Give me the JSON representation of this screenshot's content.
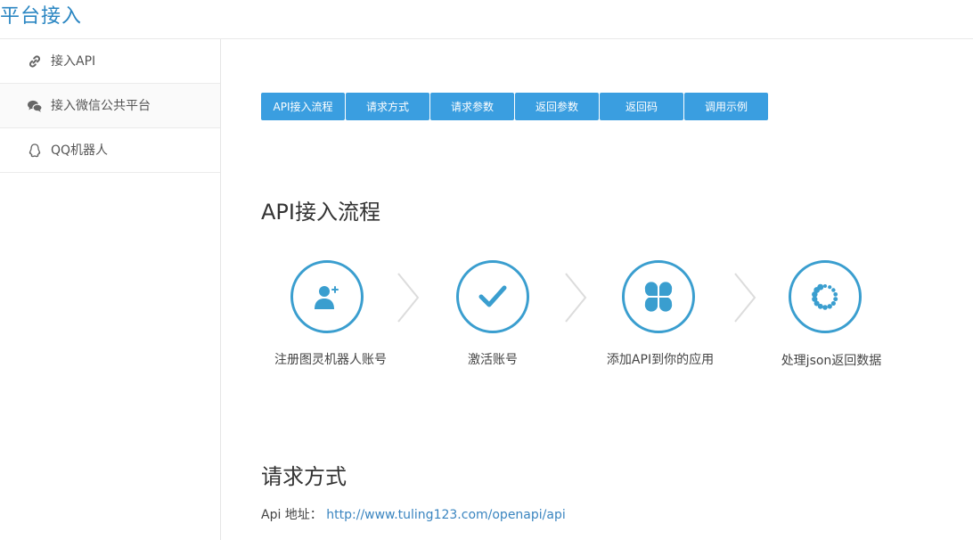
{
  "header": {
    "title": "平台接入"
  },
  "sidebar": {
    "items": [
      {
        "label": "接入API",
        "icon": "link-icon"
      },
      {
        "label": "接入微信公共平台",
        "icon": "wechat-icon"
      },
      {
        "label": "QQ机器人",
        "icon": "qq-icon"
      }
    ]
  },
  "tabs": [
    {
      "label": "API接入流程"
    },
    {
      "label": "请求方式"
    },
    {
      "label": "请求参数"
    },
    {
      "label": "返回参数"
    },
    {
      "label": "返回码"
    },
    {
      "label": "调用示例"
    }
  ],
  "flow": {
    "heading": "API接入流程",
    "steps": [
      {
        "label": "注册图灵机器人账号",
        "icon": "user-add-icon"
      },
      {
        "label": "激活账号",
        "icon": "checkmark-icon"
      },
      {
        "label": "添加API到你的应用",
        "icon": "grid-icon"
      },
      {
        "label": "处理json返回数据",
        "icon": "loading-icon"
      }
    ],
    "accent": "#3a9ecf"
  },
  "request": {
    "heading": "请求方式",
    "api_label": "Api 地址：",
    "api_url": "http://www.tuling123.com/openapi/api"
  },
  "colors": {
    "brand": "#2a86c2",
    "tab_bg": "#3a9ee0"
  }
}
